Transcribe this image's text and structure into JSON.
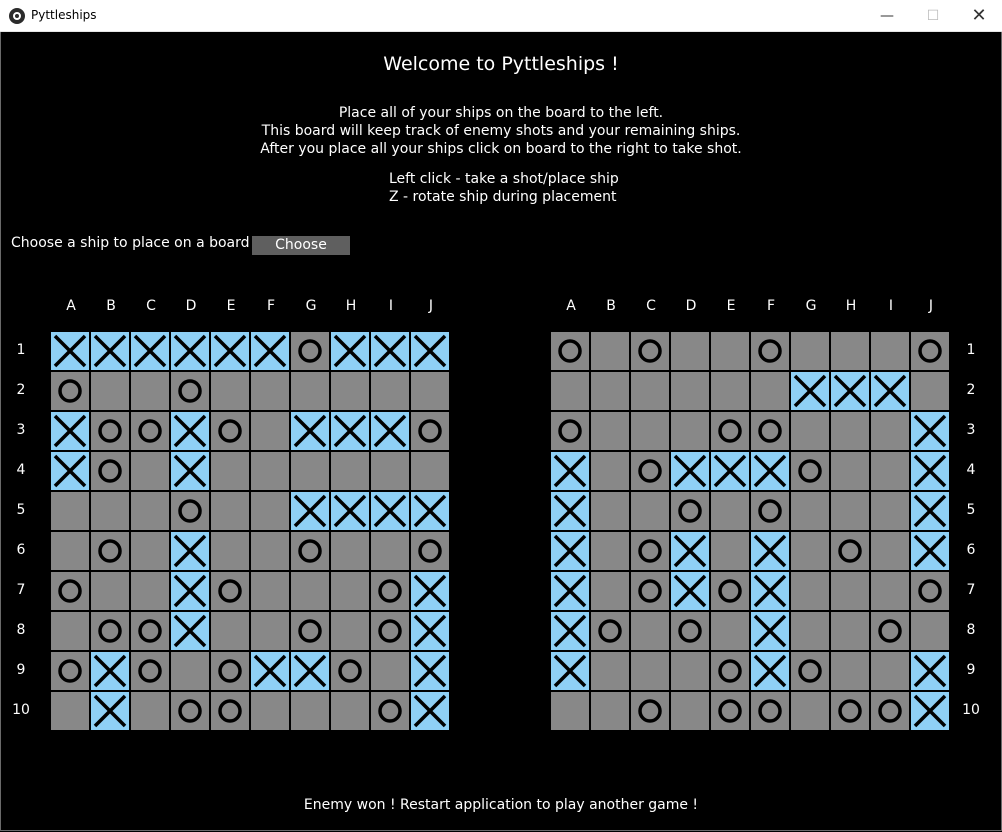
{
  "window": {
    "title": "Pyttleships",
    "minimize_glyph": "—",
    "maximize_glyph": "☐",
    "close_glyph": "✕"
  },
  "header": {
    "welcome": "Welcome to Pyttleships !",
    "instructions": [
      "Place all of your ships on the board to the left.",
      "This board will keep track of enemy shots and your remaining ships.",
      "After you place all your ships click on board to the right to take shot."
    ],
    "controls": [
      "Left click - take a shot/place ship",
      "Z - rotate ship during placement"
    ]
  },
  "ship_select": {
    "label": "Choose a ship to place on a board",
    "button": "Choose"
  },
  "columns": [
    "A",
    "B",
    "C",
    "D",
    "E",
    "F",
    "G",
    "H",
    "I",
    "J"
  ],
  "rows": [
    "1",
    "2",
    "3",
    "4",
    "5",
    "6",
    "7",
    "8",
    "9",
    "10"
  ],
  "legend": {
    "X": "hit",
    "O": "miss",
    ".": "empty"
  },
  "colors": {
    "cell": "#888888",
    "hit_cell": "#8fd0f5",
    "mark": "#000000"
  },
  "boards": {
    "player": [
      "XXXXXXOXXX",
      "O..O......",
      "XOOXO.XXXO",
      "XO.X......",
      "...O..XXXX",
      ".O.X..O..O",
      "O..XO...OX",
      ".OOX..O.OX",
      "OXO.OXXO.X",
      ".X.OO...OX"
    ],
    "enemy": [
      "O.O..O...O",
      "......XXX.",
      "O...OO...X",
      "X.OXXXO..X",
      "X..O.O...X",
      "X.OX.X.O.X",
      "X.OXOX...O",
      "XO.O.X..O.",
      "X...OXO..X",
      "..O.OO.OOX"
    ]
  },
  "status": "Enemy won ! Restart application to play another game !"
}
